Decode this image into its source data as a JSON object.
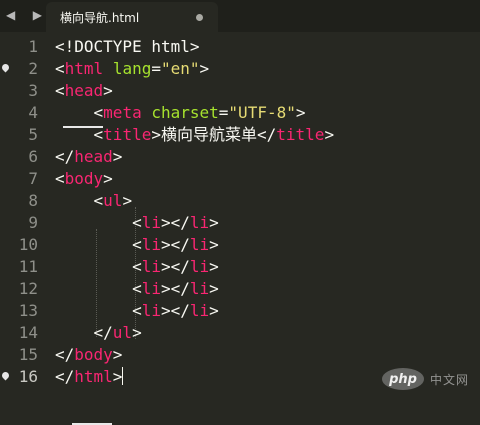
{
  "nav": {
    "back": "◀",
    "forward": "▶"
  },
  "tab": {
    "title": "横向导航.html"
  },
  "lines": [
    {
      "num": "1"
    },
    {
      "num": "2"
    },
    {
      "num": "3"
    },
    {
      "num": "4"
    },
    {
      "num": "5"
    },
    {
      "num": "6"
    },
    {
      "num": "7"
    },
    {
      "num": "8"
    },
    {
      "num": "9"
    },
    {
      "num": "10"
    },
    {
      "num": "11"
    },
    {
      "num": "12"
    },
    {
      "num": "13"
    },
    {
      "num": "14"
    },
    {
      "num": "15"
    },
    {
      "num": "16"
    }
  ],
  "code": {
    "doctype": "<!DOCTYPE html>",
    "html_tag": "html",
    "lang_attr": "lang",
    "lang_value": "\"en\"",
    "head_tag": "head",
    "meta_tag": "meta",
    "charset_attr": "charset",
    "charset_value": "\"UTF-8\"",
    "title_tag": "title",
    "title_text": "横向导航菜单",
    "body_tag": "body",
    "ul_tag": "ul",
    "li_tag": "li"
  },
  "watermark": {
    "logo": "php",
    "text": "中文网"
  },
  "colors": {
    "background": "#272822",
    "tag": "#f92672",
    "attribute": "#a6e22e",
    "string": "#e6db74",
    "text": "#f8f8f2",
    "gutter": "#8f908a"
  }
}
